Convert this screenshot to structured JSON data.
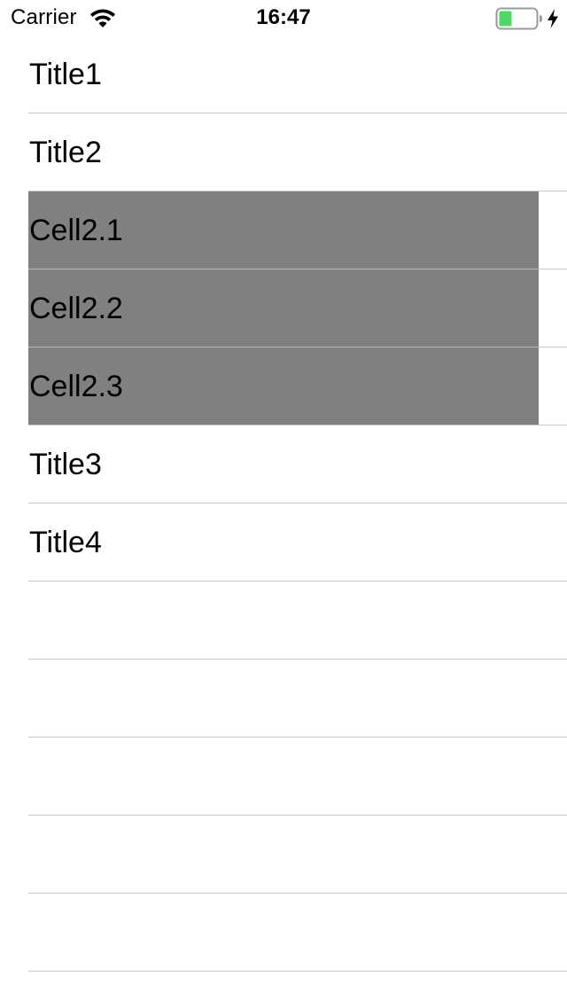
{
  "status_bar": {
    "carrier": "Carrier",
    "time": "16:47",
    "icons": [
      "wifi-icon",
      "battery-icon",
      "charging-bolt-icon"
    ],
    "battery_fill_fraction": 0.35,
    "battery_color": "#4cd964"
  },
  "table": {
    "rows": [
      {
        "label": "Title1",
        "type": "header"
      },
      {
        "label": "Title2",
        "type": "header"
      },
      {
        "label": "Cell2.1",
        "type": "sub"
      },
      {
        "label": "Cell2.2",
        "type": "sub"
      },
      {
        "label": "Cell2.3",
        "type": "sub"
      },
      {
        "label": "Title3",
        "type": "header"
      },
      {
        "label": "Title4",
        "type": "header"
      }
    ],
    "sub_cell_color": "#808080",
    "separator_color": "#c8c7cc"
  }
}
